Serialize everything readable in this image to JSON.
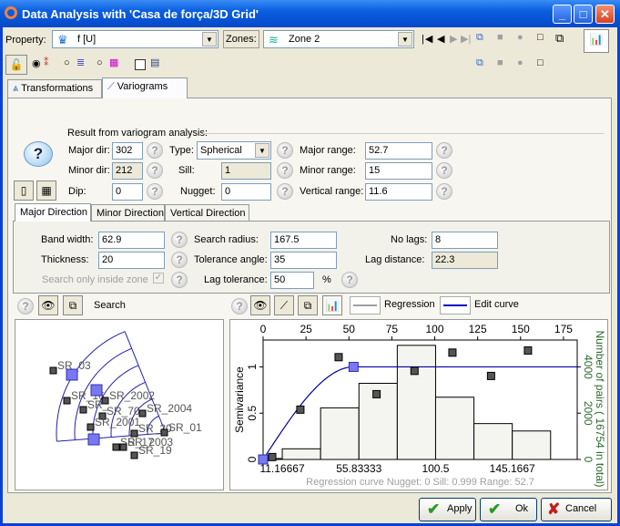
{
  "window": {
    "title": "Data Analysis with 'Casa de força/3D Grid'"
  },
  "toolbar": {
    "property_label": "Property:",
    "property_value": "f [U]",
    "zones_label": "Zones:",
    "zones_value": "Zone 2"
  },
  "tabs": [
    {
      "label": "Transformations"
    },
    {
      "label": "Variograms",
      "selected": true
    }
  ],
  "result": {
    "group_label": "Result from variogram analysis:",
    "major_dir_label": "Major dir:",
    "major_dir": "302",
    "minor_dir_label": "Minor dir:",
    "minor_dir": "212",
    "dip_label": "Dip:",
    "dip": "0",
    "type_label": "Type:",
    "type": "Spherical",
    "sill_label": "Sill:",
    "sill": "1",
    "nugget_label": "Nugget:",
    "nugget": "0",
    "major_range_label": "Major range:",
    "major_range": "52.7",
    "minor_range_label": "Minor range:",
    "minor_range": "15",
    "vertical_range_label": "Vertical range:",
    "vertical_range": "11.6"
  },
  "direction_tabs": [
    {
      "label": "Major Direction",
      "selected": true
    },
    {
      "label": "Minor Direction"
    },
    {
      "label": "Vertical Direction"
    }
  ],
  "search": {
    "band_width_label": "Band width:",
    "band_width": "62.9",
    "thickness_label": "Thickness:",
    "thickness": "20",
    "search_only_label": "Search only inside zone",
    "search_only_checked": true,
    "search_radius_label": "Search radius:",
    "search_radius": "167.5",
    "tolerance_angle_label": "Tolerance angle:",
    "tolerance_angle": "35",
    "lag_tolerance_label": "Lag tolerance:",
    "lag_tolerance": "50",
    "percent": "%",
    "no_lags_label": "No lags:",
    "no_lags": "8",
    "lag_distance_label": "Lag distance:",
    "lag_distance": "22.3"
  },
  "search_panel": {
    "title": "Search",
    "wells": [
      "SR_03",
      "SR_16",
      "SR_2002",
      "SR_",
      "SR_70",
      "SR_2004",
      "SR_2001",
      "SR_20",
      "SR_01",
      "SR_17",
      "SR_2003",
      "SR_19"
    ]
  },
  "chart_panel": {
    "legend_regression": "Regression",
    "legend_edit": "Edit curve",
    "regression_color": "#a0a0a0",
    "edit_color": "#0000c0"
  },
  "chart_data": {
    "type": "bar+scatter+line",
    "ylabel": "Semivariance",
    "y2label": "Number of pairs   ( 16754 in total)",
    "x_ticks_top": [
      0,
      25,
      50,
      75,
      100,
      125,
      150,
      175
    ],
    "x_ticks_bottom": [
      "11.16667",
      "55.83333",
      "100.5",
      "145.1667"
    ],
    "y_ticks": [
      0,
      0.5,
      1
    ],
    "y2_ticks": [
      0,
      2000,
      4000
    ],
    "xlim": [
      0,
      183
    ],
    "ylim": [
      0,
      1.29
    ],
    "y2lim": [
      0,
      5160
    ],
    "pairs_bins": [
      {
        "from": 0,
        "to": 11.17,
        "pairs": 40
      },
      {
        "from": 11.17,
        "to": 33.5,
        "pairs": 460
      },
      {
        "from": 33.5,
        "to": 55.83,
        "pairs": 2230
      },
      {
        "from": 55.83,
        "to": 78.17,
        "pairs": 3290
      },
      {
        "from": 78.17,
        "to": 100.5,
        "pairs": 4930
      },
      {
        "from": 100.5,
        "to": 122.83,
        "pairs": 2690
      },
      {
        "from": 122.83,
        "to": 145.17,
        "pairs": 1550
      },
      {
        "from": 145.17,
        "to": 167.5,
        "pairs": 1230
      }
    ],
    "experimental": [
      [
        5.3,
        0.026
      ],
      [
        21.7,
        0.538
      ],
      [
        44.0,
        1.105
      ],
      [
        66.1,
        0.705
      ],
      [
        88.2,
        0.957
      ],
      [
        110.3,
        1.154
      ],
      [
        132.8,
        0.902
      ],
      [
        154.3,
        1.177
      ]
    ],
    "model": {
      "type": "Spherical",
      "nugget": 0,
      "sill": 1,
      "range": 52.7
    },
    "control_points": [
      [
        0,
        0
      ],
      [
        52.7,
        1
      ]
    ],
    "caption": "Regression curve   Nugget: 0   Sill: 0.999   Range: 52.7"
  },
  "buttons": {
    "apply": "Apply",
    "ok": "Ok",
    "cancel": "Cancel"
  }
}
